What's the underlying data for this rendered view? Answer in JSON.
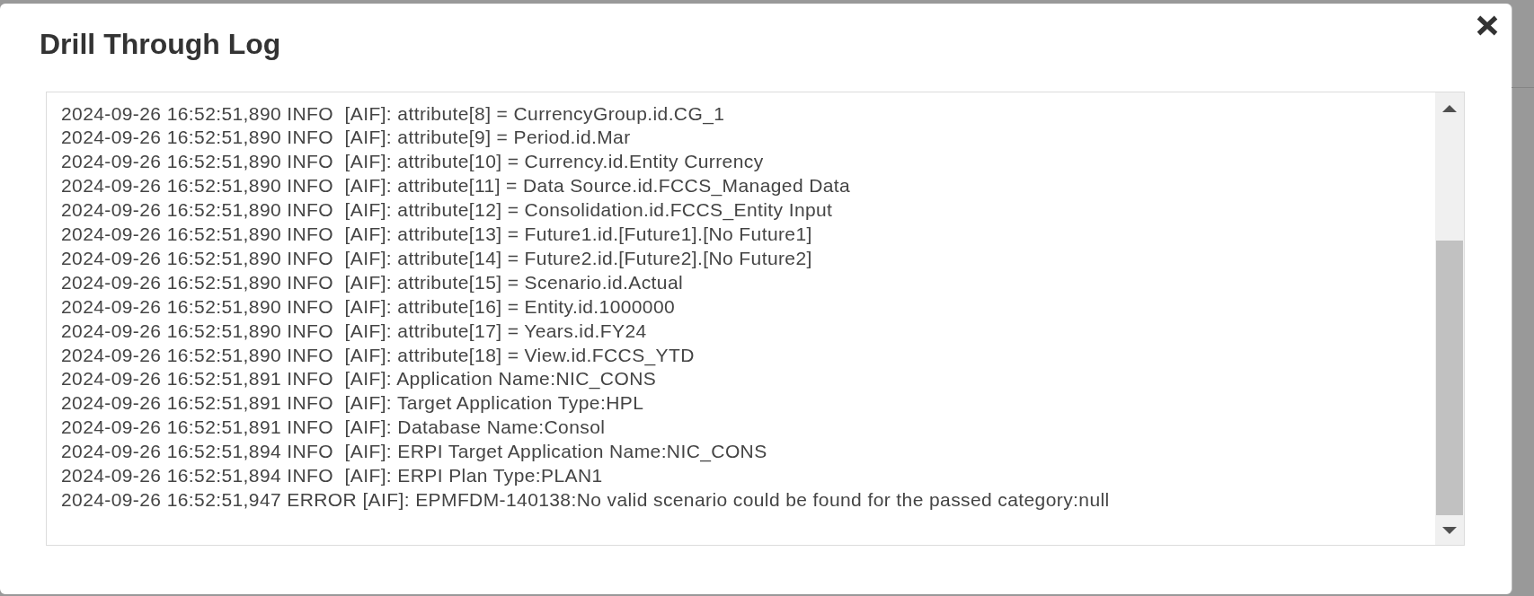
{
  "dialog": {
    "title": "Drill Through Log"
  },
  "log": {
    "lines": [
      "2024-09-26 16:52:51,890 INFO  [AIF]: attribute[8] = CurrencyGroup.id.CG_1",
      "2024-09-26 16:52:51,890 INFO  [AIF]: attribute[9] = Period.id.Mar",
      "2024-09-26 16:52:51,890 INFO  [AIF]: attribute[10] = Currency.id.Entity Currency",
      "2024-09-26 16:52:51,890 INFO  [AIF]: attribute[11] = Data Source.id.FCCS_Managed Data",
      "2024-09-26 16:52:51,890 INFO  [AIF]: attribute[12] = Consolidation.id.FCCS_Entity Input",
      "2024-09-26 16:52:51,890 INFO  [AIF]: attribute[13] = Future1.id.[Future1].[No Future1]",
      "2024-09-26 16:52:51,890 INFO  [AIF]: attribute[14] = Future2.id.[Future2].[No Future2]",
      "2024-09-26 16:52:51,890 INFO  [AIF]: attribute[15] = Scenario.id.Actual",
      "2024-09-26 16:52:51,890 INFO  [AIF]: attribute[16] = Entity.id.1000000",
      "2024-09-26 16:52:51,890 INFO  [AIF]: attribute[17] = Years.id.FY24",
      "2024-09-26 16:52:51,890 INFO  [AIF]: attribute[18] = View.id.FCCS_YTD",
      "2024-09-26 16:52:51,891 INFO  [AIF]: Application Name:NIC_CONS",
      "2024-09-26 16:52:51,891 INFO  [AIF]: Target Application Type:HPL",
      "2024-09-26 16:52:51,891 INFO  [AIF]: Database Name:Consol",
      "2024-09-26 16:52:51,894 INFO  [AIF]: ERPI Target Application Name:NIC_CONS",
      "2024-09-26 16:52:51,894 INFO  [AIF]: ERPI Plan Type:PLAN1",
      "2024-09-26 16:52:51,947 ERROR [AIF]: EPMFDM-140138:No valid scenario could be found for the passed category:null"
    ]
  }
}
